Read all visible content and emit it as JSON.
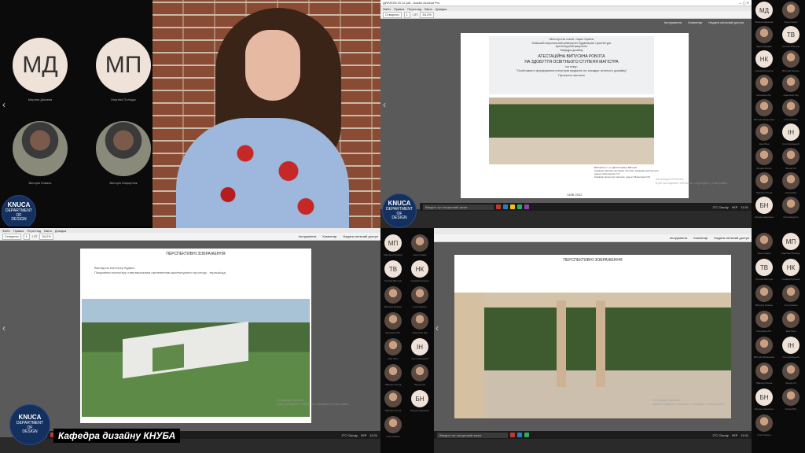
{
  "grid": {
    "tiles": [
      {
        "initials": "МД",
        "name": "Марина Дюжева"
      },
      {
        "initials": "МП",
        "name": "Мар'яна Поліщук"
      },
      {
        "initials": "",
        "name": "Вікторія Коваль"
      },
      {
        "initials": "",
        "name": "Вікторія Марценюк"
      }
    ],
    "logo": {
      "line1": "KNUCA",
      "line2": "DEPARTMENT",
      "line3": "OF",
      "line4": "DESIGN"
    }
  },
  "acrobat": {
    "title": "ДИПЛОМ 20.12.pdf - Adobe Acrobat Pro",
    "menu": [
      "Файл",
      "Правка",
      "Перегляд",
      "Вікно",
      "Довідка"
    ],
    "create_label": "Створити",
    "page_current": "1",
    "page_total": "/ 27",
    "zoom": "54,2%",
    "tools": "Інструменти",
    "comment": "Коментар",
    "share": "Надати спільний доступ"
  },
  "slide1": {
    "ministry": "Міністерство освіти і науки України",
    "univ": "Київський національний університет будівництва і архітектури",
    "faculty": "Архітектурний факультет",
    "dept": "Кафедра дизайну",
    "title1": "АТЕСТАЦІЙНА ВИПУСКНА РОБОТА",
    "title2": "НА ЗДОБУТТЯ ОСВІТНЬОГО СТУПЕНЯ МАГІСТРА",
    "title3": "на тему:",
    "topic": "\"Особливості формування інтер'єрів медіатек на засадах зеленого дизайну\"",
    "part": "Проектна частина",
    "author1": "Виконала ст. гр. ДН-61 Коваль Вікторія",
    "author2": "Керівник науково-дослідної частини, кандидат архітектури",
    "author3": "доцент Касьяненко Г.О.",
    "author4": "Керівник проектної частини: доцент Мхаилова О.В.",
    "city": "КИЇВ 2022"
  },
  "slide2": {
    "heading": "ПЕРСПЕКТИВНІ ЗОБРАЖЕННЯ",
    "line1": "Вигляд на екстер'єр будівлі.",
    "line2": "Поєднання екстер'єру з вертикальним озелененням архітектурного простору - тераса/сад"
  },
  "slide3": {
    "heading": "ПЕРСПЕКТИВНІ ЗОБРАЖЕННЯ"
  },
  "taskbar": {
    "search": "Введіть тут пошуковий запит",
    "weather": "2°C Cloudy",
    "lang": "УКР",
    "time": "11:01",
    "date": "21.12.2022"
  },
  "watermark": {
    "line1": "Активація Windows",
    "line2": "Щоб активувати Windows, перейдіть у Настройки"
  },
  "sidebar_top": [
    {
      "i": "МД",
      "n": "Марина Дюжева"
    },
    {
      "i": "",
      "n": "Анна Скарж"
    },
    {
      "i": "",
      "n": "Дарія Бурдіна"
    },
    {
      "i": "ТВ",
      "n": "Трохим Вікторія"
    },
    {
      "i": "НК",
      "n": "Назарій Кулаков"
    },
    {
      "i": "",
      "n": "Вікторія Коваль"
    },
    {
      "i": "",
      "n": "Катерина Лит"
    },
    {
      "i": "",
      "n": "Анастасія Гар"
    },
    {
      "i": "",
      "n": "Вікторія Марценюк"
    },
    {
      "i": "",
      "n": "Ілля Самоль"
    },
    {
      "i": "",
      "n": "Іван Паш"
    },
    {
      "i": "ІН",
      "n": "Ігор Новицький"
    },
    {
      "i": "",
      "n": "Богдан Волоч"
    },
    {
      "i": "",
      "n": "Леонід Ол"
    },
    {
      "i": "",
      "n": "Павлюк Олена"
    },
    {
      "i": "",
      "n": "Олена Вус"
    },
    {
      "i": "БН",
      "n": "Богдан Науменко"
    },
    {
      "i": "",
      "n": "Олександр Ко"
    }
  ],
  "sidebar_mid": [
    {
      "i": "МП",
      "n": "Мар'яна Поліщук"
    },
    {
      "i": "",
      "n": "Анна Скарж"
    },
    {
      "i": "ТВ",
      "n": "Трохим Вікторія"
    },
    {
      "i": "НК",
      "n": "Назарій Кулаков"
    },
    {
      "i": "",
      "n": "Вікторія Коваль"
    },
    {
      "i": "",
      "n": "Ілля Самоль"
    },
    {
      "i": "",
      "n": "Катерина Лит"
    },
    {
      "i": "",
      "n": "Анастасія Гар"
    },
    {
      "i": "",
      "n": "Іван Паш"
    },
    {
      "i": "ІН",
      "n": "Ігор Новицький"
    },
    {
      "i": "",
      "n": "Павлюк Олена"
    },
    {
      "i": "",
      "n": "Леонід Ол"
    },
    {
      "i": "",
      "n": "Павлюк Олена"
    },
    {
      "i": "БН",
      "n": "Богдан Науменко"
    },
    {
      "i": "",
      "n": "Ілля Самоль"
    }
  ],
  "sidebar_bot": [
    {
      "i": "",
      "n": "Анна Скарж"
    },
    {
      "i": "МП",
      "n": "Мар'яна Поліщук"
    },
    {
      "i": "ТВ",
      "n": "Трохим Вікторія"
    },
    {
      "i": "НК",
      "n": "Назарій Кулаков"
    },
    {
      "i": "",
      "n": "Вікторія Коваль"
    },
    {
      "i": "",
      "n": "Ілля Самоль"
    },
    {
      "i": "",
      "n": "Катерина Лит"
    },
    {
      "i": "",
      "n": "Іван Паш"
    },
    {
      "i": "",
      "n": "Вікторія Марценюк"
    },
    {
      "i": "ІН",
      "n": "Ігор Новицький"
    },
    {
      "i": "",
      "n": "Павлюк Олена"
    },
    {
      "i": "",
      "n": "Леонід Ол"
    },
    {
      "i": "БН",
      "n": "Богдан Науменко"
    },
    {
      "i": "",
      "n": "Олена Вус"
    },
    {
      "i": "",
      "n": "Ілля Самоль"
    }
  ],
  "caption": "Кафедра дизайну КНУБА"
}
